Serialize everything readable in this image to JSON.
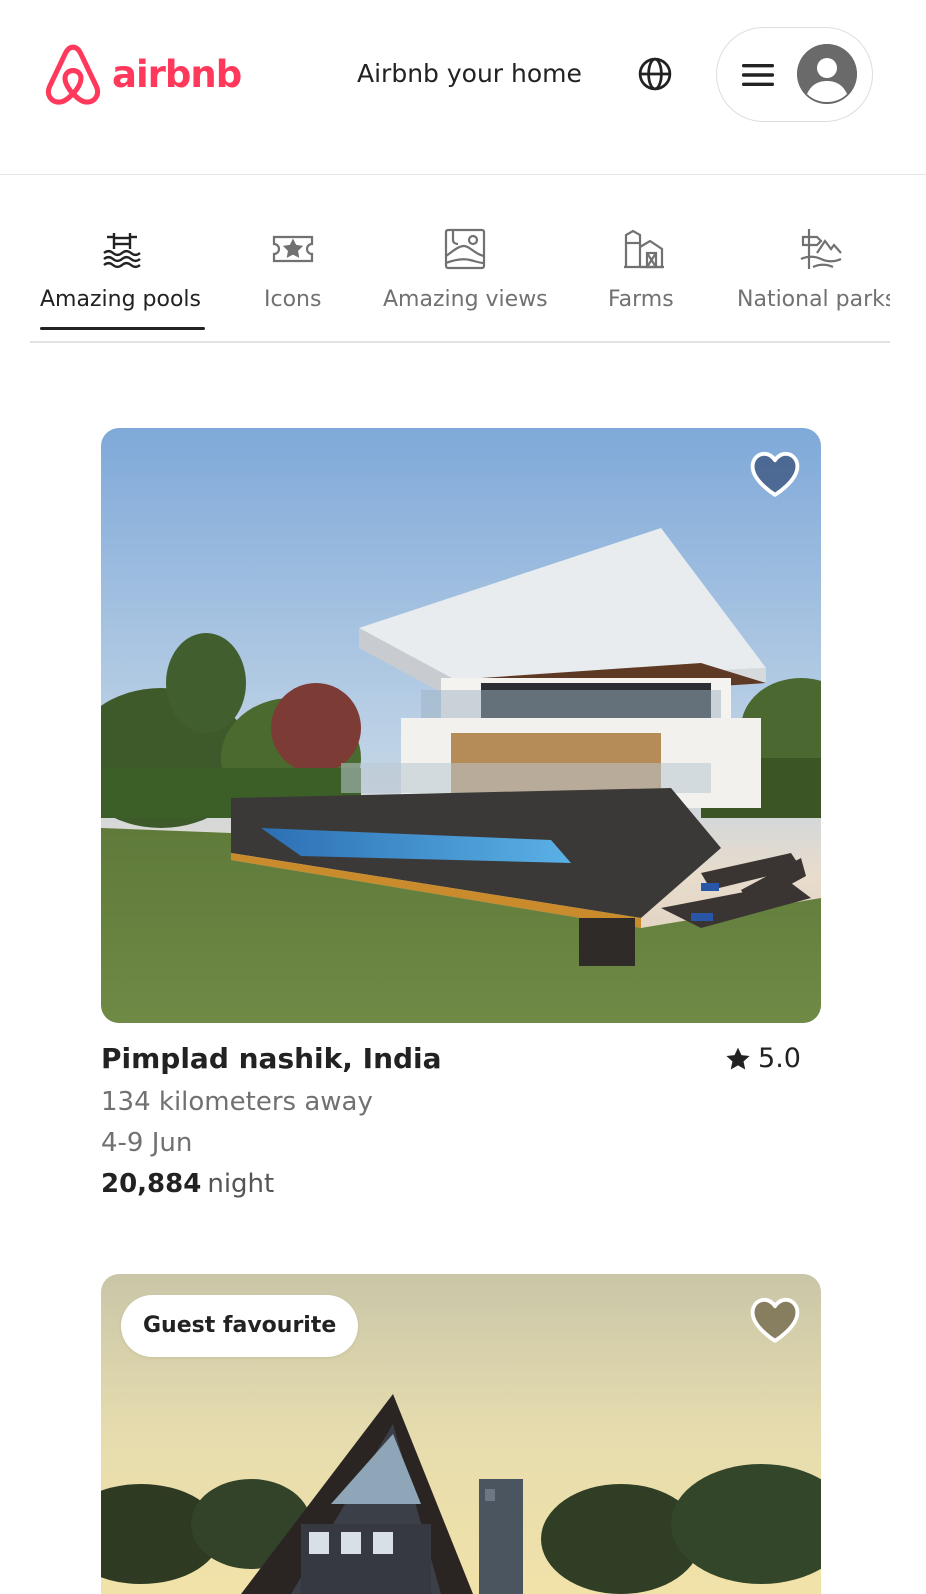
{
  "colors": {
    "brand": "#FF385C",
    "text_primary": "#222222",
    "text_secondary": "#717171",
    "divider": "#E3E3E3"
  },
  "header": {
    "logo_text": "airbnb",
    "host_link": "Airbnb your home",
    "globe_icon": "globe-icon",
    "menu_icon": "hamburger-menu-icon",
    "avatar_icon": "user-avatar-icon"
  },
  "categories": [
    {
      "label": "Amazing pools",
      "icon": "pool-icon",
      "active": true
    },
    {
      "label": "Icons",
      "icon": "ticket-star-icon",
      "active": false
    },
    {
      "label": "Amazing views",
      "icon": "framed-landscape-icon",
      "active": false
    },
    {
      "label": "Farms",
      "icon": "barn-icon",
      "active": false
    },
    {
      "label": "National parks",
      "icon": "park-sign-icon",
      "active": false
    }
  ],
  "listings": [
    {
      "location": "Pimplad nashik, India",
      "rating": "5.0",
      "distance": "134 kilometers away",
      "dates": "4-9 Jun",
      "price": "20,884",
      "price_unit": "night",
      "badge": "",
      "wishlist_icon": "heart-icon",
      "photo": "modern-villa-with-pool-photo"
    },
    {
      "location": "",
      "rating": "",
      "distance": "",
      "dates": "",
      "price": "",
      "price_unit": "",
      "badge": "Guest favourite",
      "wishlist_icon": "heart-icon",
      "photo": "a-frame-cabin-at-sunset-photo"
    }
  ]
}
